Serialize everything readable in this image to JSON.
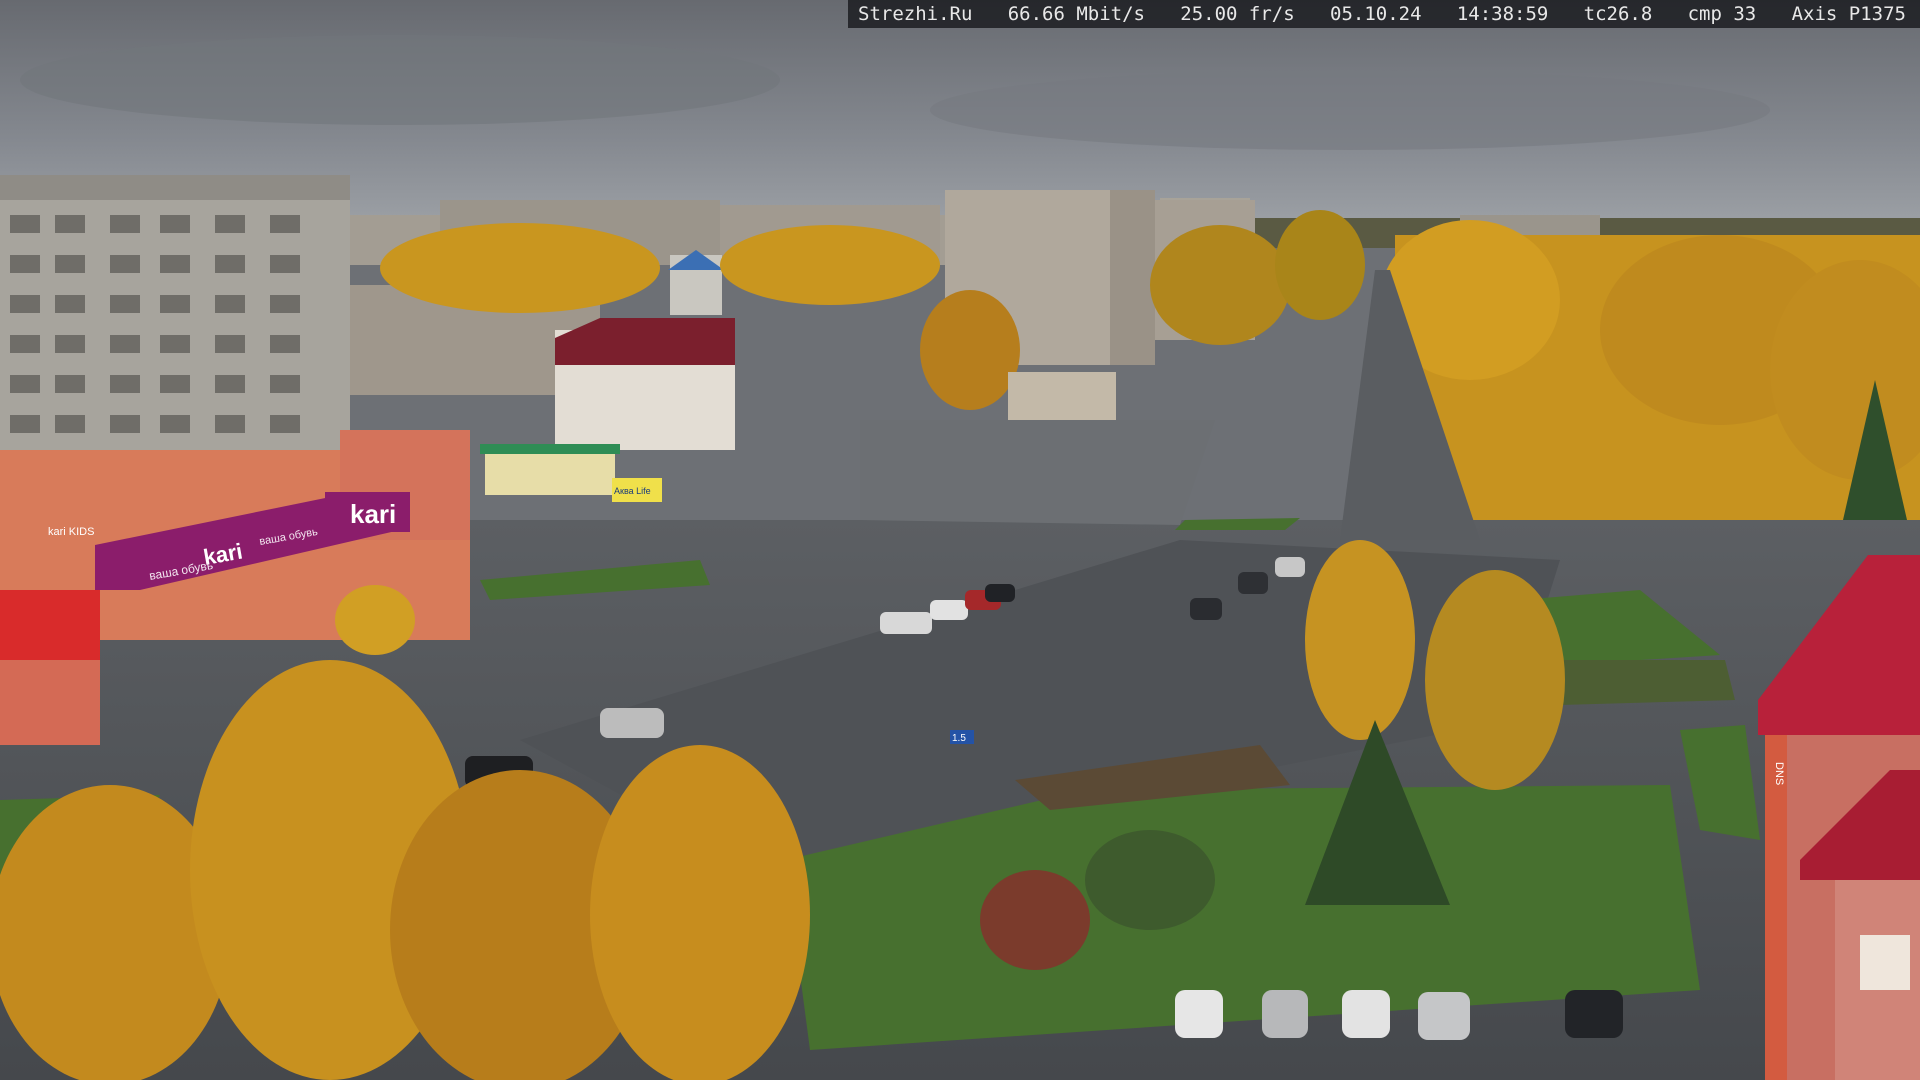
{
  "camera_overlay": {
    "site": "Strezhi.Ru",
    "bitrate": "66.66 Mbit/s",
    "framerate": "25.00 fr/s",
    "date": "05.10.24",
    "time": "14:38:59",
    "tc": "tc26.8",
    "cmp": "cmp 33",
    "model": "Axis P1375"
  },
  "storefront": {
    "kari_sign_large": "kari",
    "kari_sign_banner": "kari",
    "kari_banner_slogan": "ваша обувь",
    "kari_top_slogan": "ваша обувь",
    "kari_kids": "kari KIDS",
    "akvalife_sign": "Аква Life",
    "road_sign": "1.5",
    "building_sign_right": "DNS"
  },
  "colors": {
    "sky": "#7e8288",
    "foliage_yellow": "#c8941f",
    "foliage_orange": "#b77a1c",
    "asphalt": "#4b4e53",
    "grass": "#47702f",
    "kari_purple": "#8b1d6b",
    "building_red_roof": "#b8213a"
  }
}
